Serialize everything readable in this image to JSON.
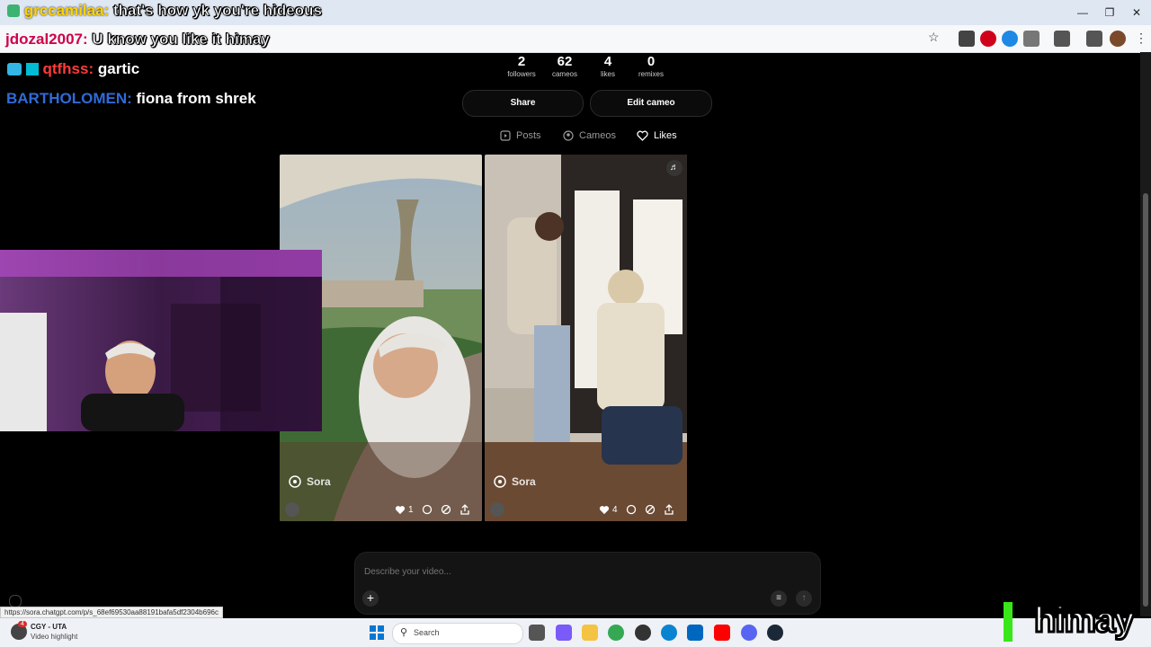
{
  "chat": [
    {
      "user": "grccamilaa:",
      "message": "that's how yk you're hideous",
      "user_color": "#ffd400"
    },
    {
      "user": "jdozal2007:",
      "message": "U know you like it himay",
      "user_color": "#d0004a"
    },
    {
      "user": "qtfhss:",
      "message": "gartic",
      "user_color": "#ff3b3b"
    },
    {
      "user": "BARTHOLOMEN:",
      "message": "fiona from shrek",
      "user_color": "#2f6bd8"
    }
  ],
  "profile": {
    "stats": [
      {
        "value": "2",
        "label": "followers"
      },
      {
        "value": "62",
        "label": "cameos"
      },
      {
        "value": "4",
        "label": "likes"
      },
      {
        "value": "0",
        "label": "remixes"
      }
    ],
    "share_label": "Share",
    "edit_label": "Edit cameo"
  },
  "tabs": [
    {
      "label": "Posts",
      "icon": "play-square-icon",
      "active": false
    },
    {
      "label": "Cameos",
      "icon": "person-circle-icon",
      "active": false
    },
    {
      "label": "Likes",
      "icon": "heart-icon",
      "active": true
    }
  ],
  "cards": [
    {
      "brand": "Sora",
      "likes": "1",
      "scene": "tornado-doorbell"
    },
    {
      "brand": "Sora",
      "likes": "4",
      "scene": "proposal"
    }
  ],
  "prompt": {
    "placeholder": "Describe your video..."
  },
  "status_url": "https://sora.chatgpt.com/p/s_68ef69530aa88191bafa5df2304b696c",
  "taskbar": {
    "notification_badge": "4",
    "weather_title": "CGY - UTA",
    "weather_subtitle": "Video highlight",
    "search_label": "Search"
  },
  "streamer_logo": "himay",
  "colors": {
    "accent": "#1a73e8",
    "background": "#000000"
  }
}
